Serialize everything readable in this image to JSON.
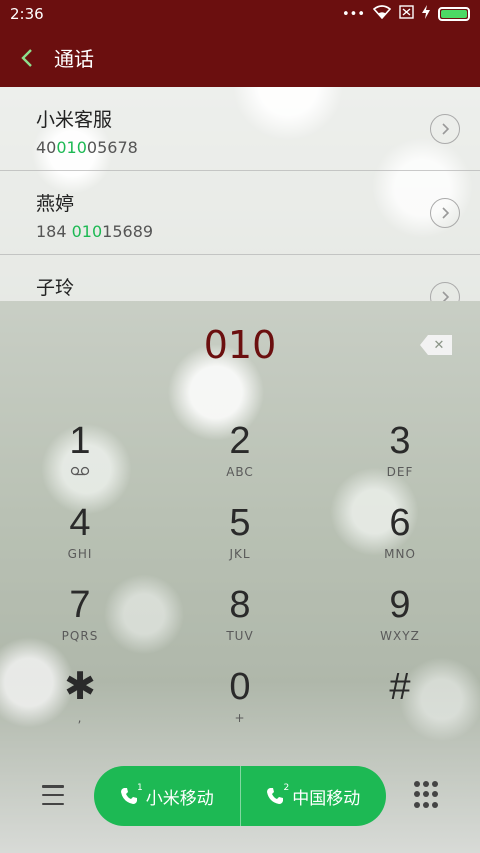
{
  "status": {
    "time": "2:36",
    "dots": "•••",
    "battery_level": 1.0,
    "colors": {
      "bar": "#6b0f0f",
      "battery": "#4cd964"
    }
  },
  "header": {
    "title": "通话",
    "back_icon": "chevron-left-icon"
  },
  "results": [
    {
      "name": "小米客服",
      "number_pre": "40",
      "number_match": "010",
      "number_post": "05678"
    },
    {
      "name": "燕婷",
      "number_pre": "184 ",
      "number_match": "010",
      "number_post": "15689"
    },
    {
      "name": "子玲",
      "number_pre": "",
      "number_match": "",
      "number_post": ""
    }
  ],
  "dialer": {
    "digits": "010",
    "keys": [
      {
        "digit": "1",
        "letters": "ꝏ"
      },
      {
        "digit": "2",
        "letters": "ABC"
      },
      {
        "digit": "3",
        "letters": "DEF"
      },
      {
        "digit": "4",
        "letters": "GHI"
      },
      {
        "digit": "5",
        "letters": "JKL"
      },
      {
        "digit": "6",
        "letters": "MNO"
      },
      {
        "digit": "7",
        "letters": "PQRS"
      },
      {
        "digit": "8",
        "letters": "TUV"
      },
      {
        "digit": "9",
        "letters": "WXYZ"
      },
      {
        "digit": "✱",
        "letters": ","
      },
      {
        "digit": "0",
        "letters": "+"
      },
      {
        "digit": "#",
        "letters": ""
      }
    ]
  },
  "bottom": {
    "call_sim1_label": "小米移动",
    "call_sim2_label": "中国移动",
    "sim1_badge": "1",
    "sim2_badge": "2",
    "accent": "#1db954"
  }
}
